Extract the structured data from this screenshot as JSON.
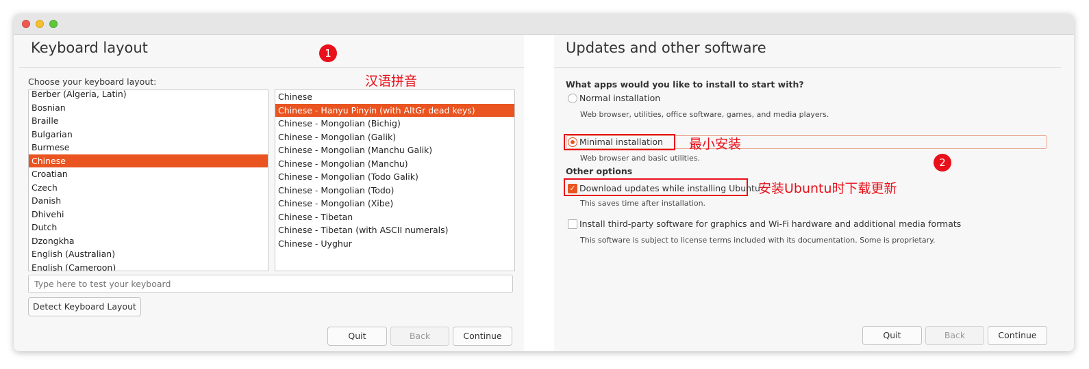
{
  "left": {
    "title": "Keyboard layout",
    "choose_label": "Choose your keyboard layout:",
    "layouts": [
      "Berber (Algeria, Latin)",
      "Bosnian",
      "Braille",
      "Bulgarian",
      "Burmese",
      "Chinese",
      "Croatian",
      "Czech",
      "Danish",
      "Dhivehi",
      "Dutch",
      "Dzongkha",
      "English (Australian)",
      "English (Cameroon)"
    ],
    "selected_layout_index": 5,
    "variants": [
      "Chinese",
      "Chinese - Hanyu Pinyin (with AltGr dead keys)",
      "Chinese - Mongolian (Bichig)",
      "Chinese - Mongolian (Galik)",
      "Chinese - Mongolian (Manchu Galik)",
      "Chinese - Mongolian (Manchu)",
      "Chinese - Mongolian (Todo Galik)",
      "Chinese - Mongolian (Todo)",
      "Chinese - Mongolian (Xibe)",
      "Chinese - Tibetan",
      "Chinese - Tibetan (with ASCII numerals)",
      "Chinese - Uyghur"
    ],
    "selected_variant_index": 1,
    "test_placeholder": "Type here to test your keyboard",
    "detect_label": "Detect Keyboard Layout",
    "quit_label": "Quit",
    "back_label": "Back",
    "continue_label": "Continue",
    "marker": "1",
    "annotation": "汉语拼音"
  },
  "right": {
    "title": "Updates and other software",
    "question": "What apps would you like to install to start with?",
    "normal_label": "Normal installation",
    "normal_desc": "Web browser, utilities, office software, games, and media players.",
    "minimal_label": "Minimal installation",
    "minimal_desc": "Web browser and basic utilities.",
    "minimal_selected": true,
    "other_options": "Other options",
    "download_label": "Download updates while installing Ubuntu",
    "download_desc": "This saves time after installation.",
    "download_checked": true,
    "thirdparty_label": "Install third-party software for graphics and Wi-Fi hardware and additional media formats",
    "thirdparty_desc": "This software is subject to license terms included with its documentation. Some is proprietary.",
    "thirdparty_checked": false,
    "quit_label": "Quit",
    "back_label": "Back",
    "continue_label": "Continue",
    "marker": "2",
    "annotation_minimal": "最小安装",
    "annotation_updates": "安装Ubuntu时下载更新"
  },
  "colors": {
    "accent": "#e95420",
    "annotation": "#e8101a"
  }
}
